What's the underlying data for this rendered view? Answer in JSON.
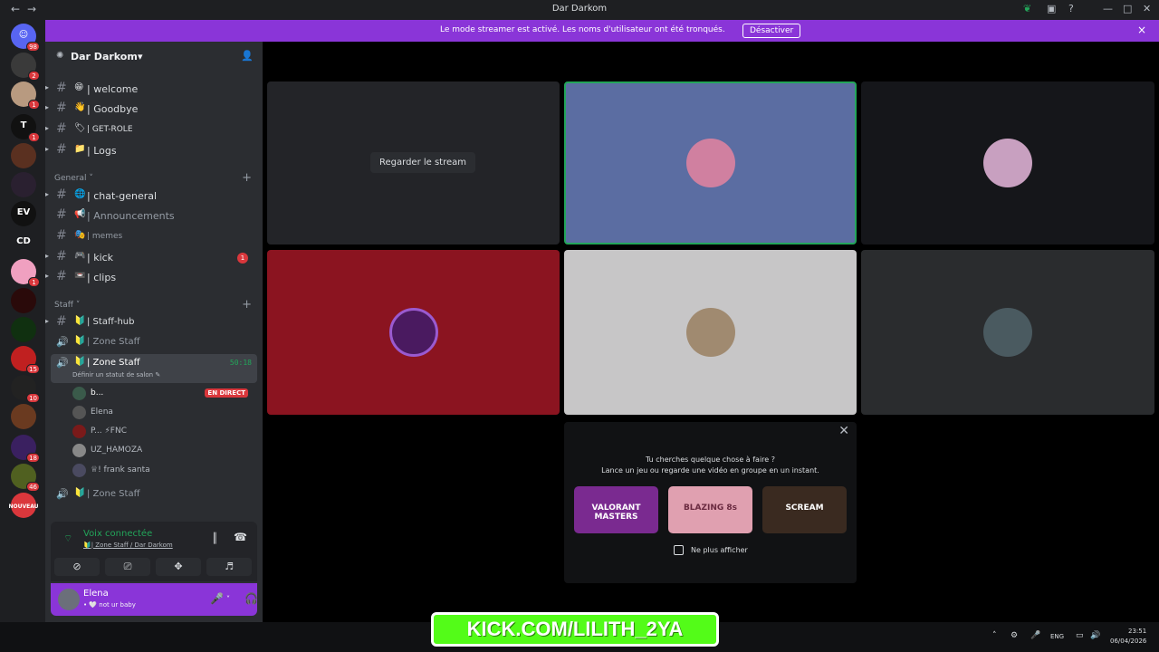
{
  "window": {
    "title": "Dar Darkom",
    "back": "←",
    "forward": "→"
  },
  "notice": {
    "text": "Le mode streamer est activé. Les noms d'utilisateur ont été tronqués.",
    "button": "Désactiver",
    "close": "×"
  },
  "server_badges": [
    "98",
    "2",
    "1",
    "1",
    "",
    "",
    "",
    "",
    "1",
    "",
    "",
    "15",
    "10",
    "",
    "18",
    "46",
    ""
  ],
  "server_text": {
    "cd": "CD",
    "nouveau": "NOUVEAU"
  },
  "server": {
    "name": "Dar Darkom",
    "caret": "▾"
  },
  "channels_top": [
    {
      "name": "| welcome",
      "emoji": "😁"
    },
    {
      "name": "| Goodbye",
      "emoji": "👋"
    },
    {
      "name": "| GET-ROLE",
      "emoji": "🏷"
    },
    {
      "name": "| Logs",
      "emoji": "📁"
    }
  ],
  "cat_general": "General",
  "channels_general": [
    {
      "name": "| chat-general",
      "emoji": "🌐"
    },
    {
      "name": "| Announcements",
      "emoji": "📢"
    },
    {
      "name": "| memes",
      "emoji": "🎭"
    },
    {
      "name": "| kick",
      "emoji": "🎮",
      "count": "1"
    },
    {
      "name": "| clips",
      "emoji": "📼"
    }
  ],
  "cat_staff": "Staff",
  "channels_staff": [
    {
      "name": "| Staff-hub",
      "emoji": "🔰"
    },
    {
      "name": "| Zone Staff",
      "emoji": "🔰"
    }
  ],
  "active_voice": {
    "name": "| Zone Staff",
    "timer": "50:18",
    "status": "Définir un statut de salon ✎"
  },
  "voice_users": [
    {
      "name": "b...",
      "live": "EN DIRECT"
    },
    {
      "name": "Elena"
    },
    {
      "name": "P... ⚡FNC"
    },
    {
      "name": "UZ_HAMOZA"
    },
    {
      "name": "♕! frank santa"
    }
  ],
  "channel_after": {
    "name": "| Zone Staff",
    "emoji": "🔰"
  },
  "voice_panel": {
    "title": "Voix connectée",
    "sub": "🔰| Zone Staff / Dar Darkom"
  },
  "user": {
    "name": "Elena",
    "status": "• 🤍 not ur baby"
  },
  "stage": {
    "watch": "Regarder le stream"
  },
  "activity": {
    "line1": "Tu cherches quelque chose à faire ?",
    "line2": "Lance un jeu ou regarde une vidéo en groupe en un instant.",
    "cards": [
      "VALORANT MASTERS",
      "BLAZING 8s",
      "SCREAM"
    ],
    "dont_show": "Ne plus afficher"
  },
  "overlay": {
    "kick": "KICK.COM/LILITH_2YA"
  },
  "tray": {
    "lang": "ENG",
    "time": "23:51",
    "date": "06/04/2026"
  },
  "colors": {
    "accent": "#8a35d8",
    "green": "#23a55a",
    "red": "#da373c",
    "kick": "#53fc18"
  }
}
